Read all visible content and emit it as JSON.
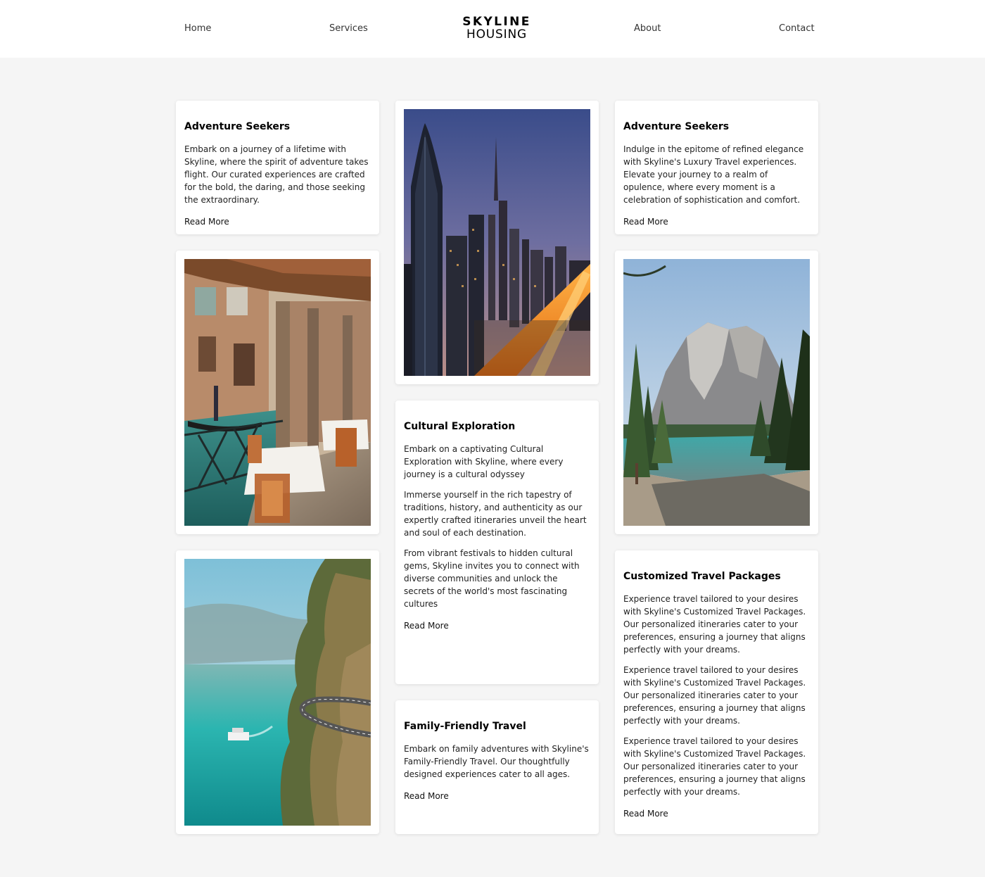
{
  "nav": {
    "home": "Home",
    "services": "Services",
    "about": "About",
    "contact": "Contact"
  },
  "brand": {
    "line1": "SKYLINE",
    "line2": "HOUSING"
  },
  "cards": {
    "adventure_left": {
      "title": "Adventure Seekers",
      "lines": [
        "Embark on a journey of a lifetime with",
        "Skyline, where the spirit of adventure takes",
        "flight. Our curated experiences are crafted",
        "for the bold, the daring, and those seeking",
        "the extraordinary."
      ],
      "link": "Read More"
    },
    "adventure_right": {
      "title": "Adventure Seekers",
      "lines": [
        "Indulge in the epitome of refined elegance",
        "with Skyline's Luxury Travel experiences.",
        "Elevate your journey to a realm of",
        "opulence, where every moment is a",
        "celebration of sophistication and comfort."
      ],
      "link": "Read More"
    },
    "cultural": {
      "title": "Cultural Exploration",
      "p1": [
        "Embark on a captivating Cultural",
        "Exploration with Skyline, where every",
        "journey is a cultural odyssey"
      ],
      "p2": [
        "Immerse yourself in the rich tapestry of",
        "traditions, history, and authenticity as our",
        "expertly crafted itineraries unveil the heart",
        "and soul of each destination."
      ],
      "p3": [
        "From vibrant festivals to hidden cultural",
        "gems, Skyline invites you to connect with",
        "diverse communities and unlock the",
        "secrets of the world's most fascinating",
        "cultures"
      ],
      "link": "Read More"
    },
    "family": {
      "title": "Family-Friendly Travel",
      "lines": [
        "Embark on family adventures with Skyline's",
        "Family-Friendly Travel. Our thoughtfully",
        "designed experiences cater to all ages."
      ],
      "link": "Read More"
    },
    "custom": {
      "title": "Customized Travel Packages",
      "lines": [
        "Experience travel tailored to your desires",
        "with Skyline's Customized Travel Packages.",
        "Our personalized itineraries cater to your",
        "preferences, ensuring a journey that aligns",
        "perfectly with your dreams."
      ],
      "link": "Read More"
    }
  },
  "colors": {
    "page_background": "#f5f5f5",
    "card_background": "#ffffff",
    "text": "#111111"
  },
  "icons": {
    "photo_venice": "venice-canal-terrace-photo",
    "photo_city": "night-city-skyline-photo",
    "photo_lake": "mountain-lake-photo",
    "photo_coast": "coastal-cliff-road-photo"
  }
}
